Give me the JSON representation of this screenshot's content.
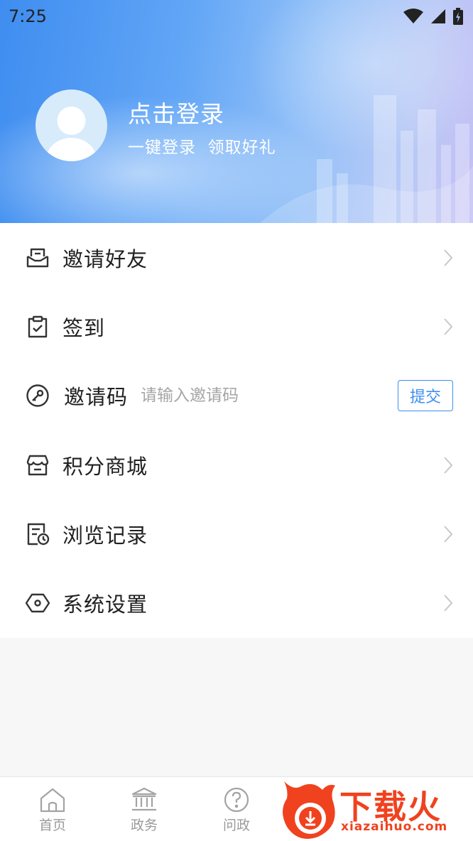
{
  "status_bar": {
    "time": "7:25"
  },
  "header": {
    "title": "点击登录",
    "subtitle": "一键登录  领取好礼"
  },
  "menu": {
    "items": [
      {
        "label": "邀请好友",
        "icon": "invite-envelope-icon"
      },
      {
        "label": "签到",
        "icon": "checkin-clipboard-icon"
      },
      {
        "label": "邀请码",
        "icon": "key-icon",
        "placeholder": "请输入邀请码",
        "button": "提交"
      },
      {
        "label": "积分商城",
        "icon": "store-icon"
      },
      {
        "label": "浏览记录",
        "icon": "history-icon"
      },
      {
        "label": "系统设置",
        "icon": "settings-hex-icon"
      }
    ]
  },
  "bottom_nav": {
    "items": [
      {
        "label": "首页",
        "icon": "home-icon"
      },
      {
        "label": "政务",
        "icon": "government-icon"
      },
      {
        "label": "问政",
        "icon": "question-icon"
      }
    ]
  },
  "watermark": {
    "text": "下载火",
    "url": "xiazaihuo.com"
  },
  "colors": {
    "accent": "#3d8ff0",
    "text": "#1f1f1f",
    "muted": "#9a9a9a",
    "watermark": "#f0421f"
  }
}
